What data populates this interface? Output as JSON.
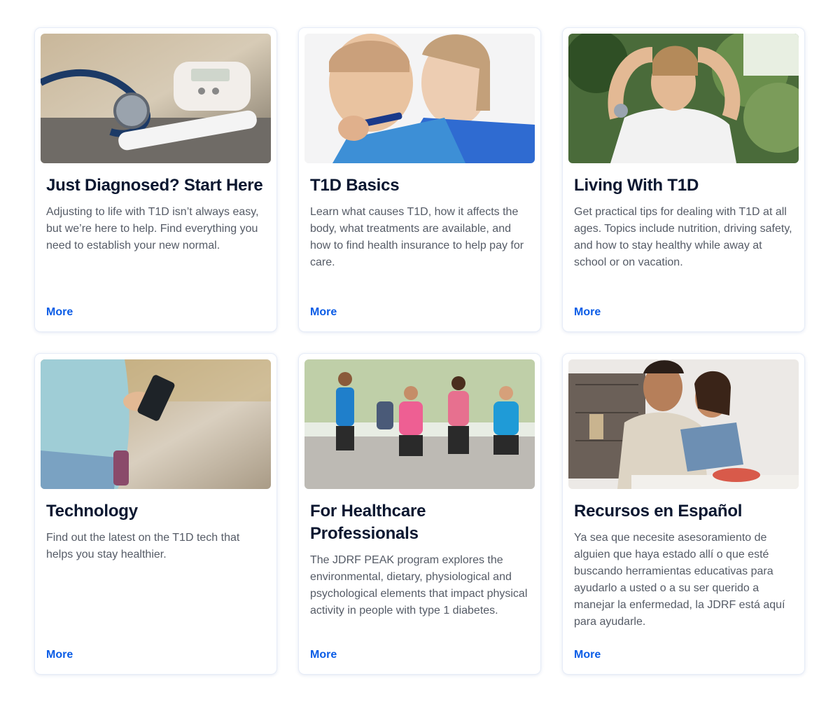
{
  "cards": [
    {
      "title": "Just Diagnosed? Start Here",
      "body": "Adjusting to life with T1D isn’t always easy, but we’re here to help. Find everything you need to establish your new normal.",
      "link": "More"
    },
    {
      "title": "T1D Basics",
      "body": "Learn what causes T1D, how it affects the body, what treatments are available, and how to find health insurance to help pay for care.",
      "link": "More"
    },
    {
      "title": "Living With T1D",
      "body": "Get practical tips for dealing with T1D at all ages. Topics include nutrition, driving safety, and how to stay healthy while away at school or on vacation.",
      "link": "More"
    },
    {
      "title": "Technology",
      "body": "Find out the latest on the T1D tech that helps you stay healthier.",
      "link": "More"
    },
    {
      "title": "For Healthcare Professionals",
      "body": "The JDRF PEAK program explores the environmental, dietary, physiological and psychological elements that impact physical activity in people with type 1 diabetes.",
      "link": "More"
    },
    {
      "title": "Recursos en Español",
      "body": "Ya sea que necesite asesoramiento de alguien que haya estado allí o que esté buscando herramientas educativas para ayudarlo a usted o a su ser querido a manejar la enfermedad, la JDRF está aquí para ayudarle.",
      "link": "More"
    }
  ],
  "colors": {
    "link": "#0a5ce6",
    "title": "#0b1730",
    "body": "#555b66"
  }
}
